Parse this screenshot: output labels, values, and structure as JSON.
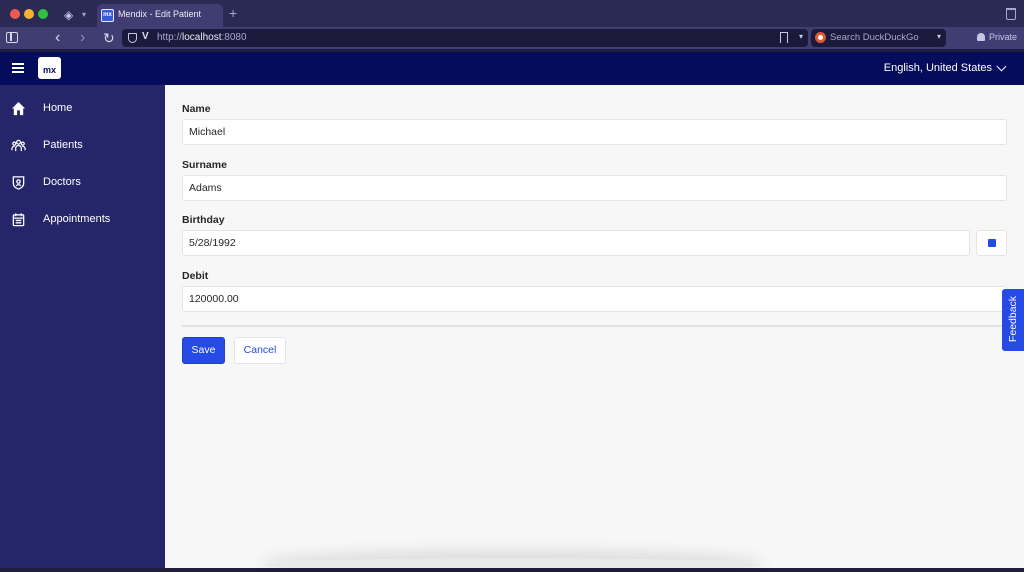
{
  "browser": {
    "tab_title": "Mendix - Edit Patient",
    "tab_favicon": "mx",
    "url_prefix": "http://",
    "url_host": "localhost",
    "url_port": ":8080",
    "search_placeholder": "Search DuckDuckGo",
    "private_label": "Private",
    "icons": {
      "back": "‹",
      "forward": "›",
      "reload": "↻",
      "new_tab": "+",
      "caret": "▾",
      "layers": "◈"
    }
  },
  "app": {
    "logo_text": "mx",
    "language": "English, United States",
    "brand_color": "#060c5c",
    "sidebar_color": "#252669",
    "accent_color": "#264ae5"
  },
  "sidebar": {
    "items": [
      {
        "label": "Home",
        "icon": "home-icon"
      },
      {
        "label": "Patients",
        "icon": "patients-icon"
      },
      {
        "label": "Doctors",
        "icon": "doctor-badge-icon"
      },
      {
        "label": "Appointments",
        "icon": "calendar-icon"
      }
    ]
  },
  "form": {
    "name": {
      "label": "Name",
      "value": "Michael"
    },
    "surname": {
      "label": "Surname",
      "value": "Adams"
    },
    "birthday": {
      "label": "Birthday",
      "value": "5/28/1992"
    },
    "debit": {
      "label": "Debit",
      "value": "120000.00"
    },
    "save_label": "Save",
    "cancel_label": "Cancel"
  },
  "feedback_label": "Feedback"
}
